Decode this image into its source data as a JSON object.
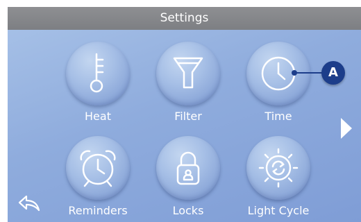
{
  "header": {
    "title": "Settings"
  },
  "tiles": [
    {
      "label": "Heat",
      "icon": "thermometer-icon"
    },
    {
      "label": "Filter",
      "icon": "filter-funnel-icon"
    },
    {
      "label": "Time",
      "icon": "clock-icon"
    },
    {
      "label": "Reminders",
      "icon": "alarm-clock-icon"
    },
    {
      "label": "Locks",
      "icon": "lock-icon"
    },
    {
      "label": "Light Cycle",
      "icon": "light-cycle-icon"
    }
  ],
  "navigation": {
    "next_icon": "right-triangle-icon",
    "back_icon": "back-arrow-icon"
  },
  "callout": {
    "label": "A"
  },
  "colors": {
    "title_bar": "#808184",
    "background": "#8facdd",
    "callout": "#1c3d8a",
    "text": "#ffffff"
  }
}
